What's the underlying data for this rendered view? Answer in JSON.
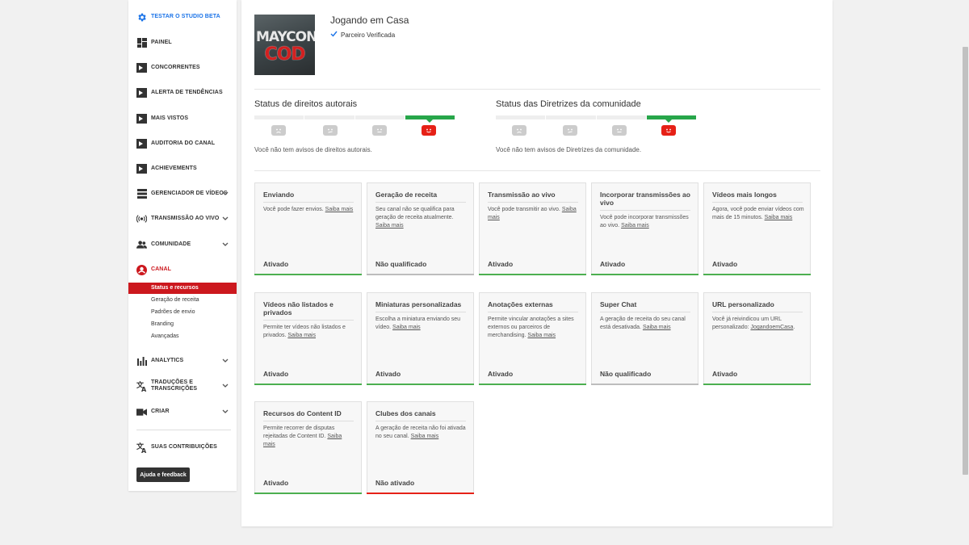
{
  "sidebar": {
    "items": [
      {
        "label": "TESTAR O STUDIO BETA",
        "icon": "gear-icon"
      },
      {
        "label": "PAINEL",
        "icon": "dashboard-icon"
      },
      {
        "label": "CONCORRENTES",
        "icon": "plugin-icon"
      },
      {
        "label": "ALERTA DE TENDÊNCIAS",
        "icon": "plugin-icon"
      },
      {
        "label": "MAIS VISTOS",
        "icon": "plugin-icon"
      },
      {
        "label": "AUDITORIA DO CANAL",
        "icon": "plugin-icon"
      },
      {
        "label": "ACHIEVEMENTS",
        "icon": "plugin-icon"
      },
      {
        "label": "GERENCIADOR DE VÍDEOS",
        "icon": "video-manager-icon"
      },
      {
        "label": "TRANSMISSÃO AO VIVO",
        "icon": "live-icon"
      },
      {
        "label": "COMUNIDADE",
        "icon": "community-icon"
      },
      {
        "label": "CANAL",
        "icon": "channel-icon"
      },
      {
        "label": "ANALYTICS",
        "icon": "analytics-icon"
      },
      {
        "label": "TRADUÇÕES E TRANSCRIÇÕES",
        "icon": "translate-icon"
      },
      {
        "label": "CRIAR",
        "icon": "camera-icon"
      },
      {
        "label": "SUAS CONTRIBUIÇÕES",
        "icon": "translate-icon"
      }
    ],
    "subitems": [
      "Status e recursos",
      "Geração de receita",
      "Padrões de envio",
      "Branding",
      "Avançadas"
    ],
    "help_label": "Ajuda e feedback"
  },
  "channel": {
    "name": "Jogando em Casa",
    "verified_label": "Parceiro Verificada",
    "thumb_line1": "MAYCON",
    "thumb_line2": "COD"
  },
  "copyright": {
    "title": "Status de direitos autorais",
    "desc": "Você não tem avisos de direitos autorais."
  },
  "community": {
    "title": "Status das Diretrizes da comunidade",
    "desc": "Você não tem avisos de Diretrizes da comunidade."
  },
  "cards": [
    {
      "title": "Enviando",
      "desc": "Você pode fazer envios.",
      "link": "Saiba mais",
      "status": "Ativado"
    },
    {
      "title": "Geração de receita",
      "desc": "Seu canal não se qualifica para geração de receita atualmente.",
      "link": "Saiba mais",
      "status": "Não qualificado"
    },
    {
      "title": "Transmissão ao vivo",
      "desc": "Você pode transmitir ao vivo.",
      "link": "Saiba mais",
      "status": "Ativado"
    },
    {
      "title": "Incorporar transmissões ao vivo",
      "desc": "Você pode incorporar transmissões ao vivo.",
      "link": "Saiba mais",
      "status": "Ativado"
    },
    {
      "title": "Vídeos mais longos",
      "desc": "Agora, você pode enviar vídeos com mais de 15 minutos.",
      "link": "Saiba mais",
      "status": "Ativado"
    },
    {
      "title": "Vídeos não listados e privados",
      "desc": "Permite ter vídeos não listados e privados.",
      "link": "Saiba mais",
      "status": "Ativado"
    },
    {
      "title": "Miniaturas personalizadas",
      "desc": "Escolha a miniatura enviando seu vídeo.",
      "link": "Saiba mais",
      "status": "Ativado"
    },
    {
      "title": "Anotações externas",
      "desc": "Permite vincular anotações a sites externos ou parceiros de merchandising.",
      "link": "Saiba mais",
      "status": "Ativado"
    },
    {
      "title": "Super Chat",
      "desc": "A geração de receita do seu canal está desativada.",
      "link": "Saiba mais",
      "status": "Não qualificado"
    },
    {
      "title": "URL personalizado",
      "desc": "Você já reivindicou um URL personalizado:",
      "link": "JogandoemCasa",
      "suffix": ".",
      "status": "Ativado"
    },
    {
      "title": "Recursos do Content ID",
      "desc": "Permite recorrer de disputas rejeitadas de Content ID.",
      "link": "Saiba mais",
      "status": "Ativado"
    },
    {
      "title": "Clubes dos canais",
      "desc": "A geração de receita não foi ativada no seu canal.",
      "link": "Saiba mais",
      "status": "Não ativado"
    }
  ],
  "colors": {
    "accent_red": "#cc181e",
    "green": "#4caf50",
    "blue": "#1a73e8"
  }
}
